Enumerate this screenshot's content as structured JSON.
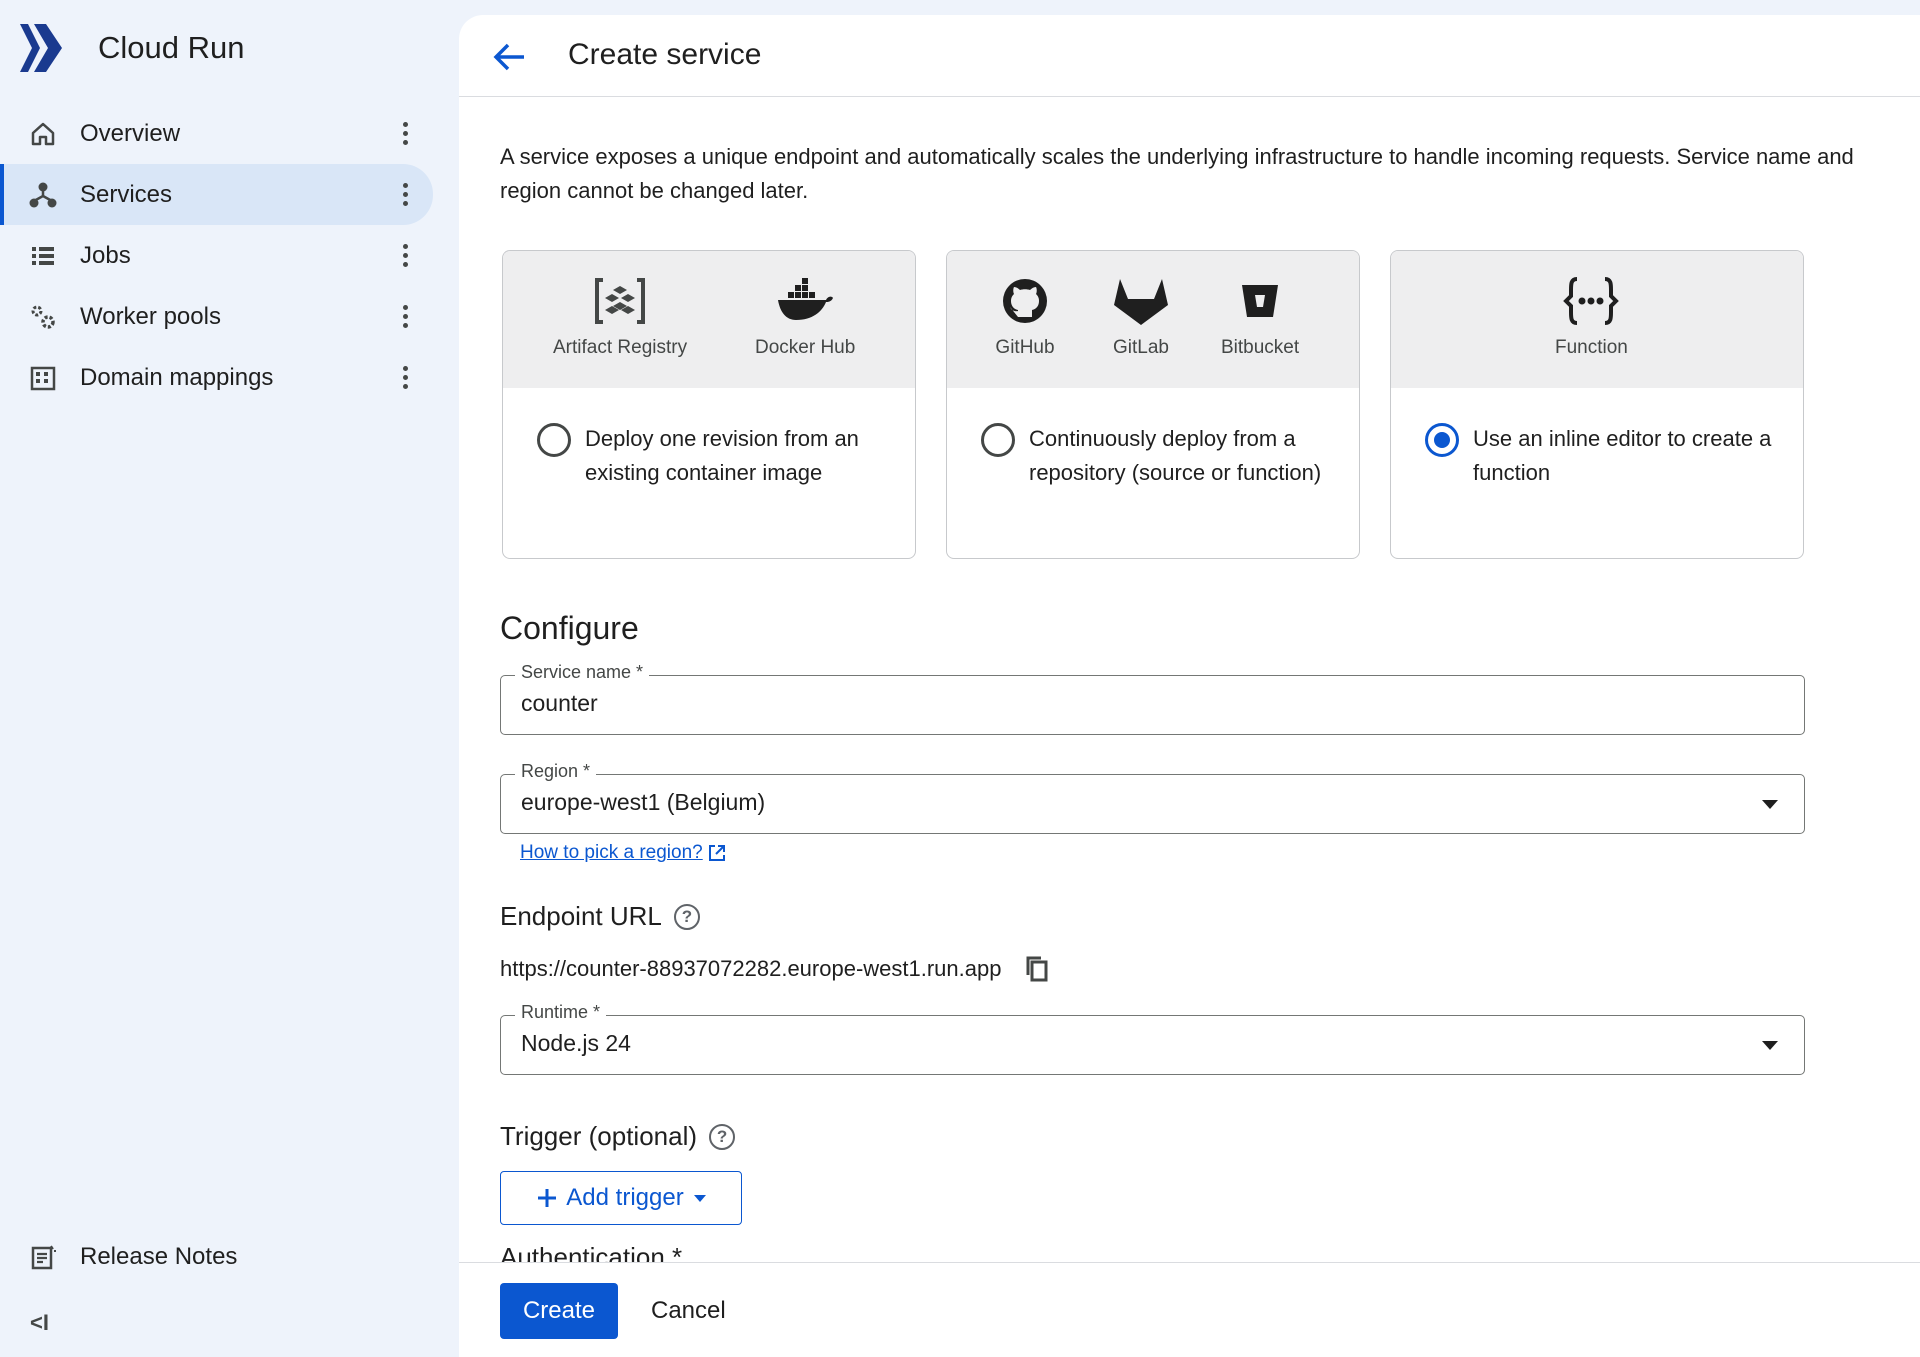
{
  "app": {
    "title": "Cloud Run"
  },
  "sidebar": {
    "items": [
      {
        "label": "Overview",
        "icon": "home-icon"
      },
      {
        "label": "Services",
        "icon": "services-icon",
        "active": true
      },
      {
        "label": "Jobs",
        "icon": "list-icon"
      },
      {
        "label": "Worker pools",
        "icon": "gears-icon"
      },
      {
        "label": "Domain mappings",
        "icon": "building-icon"
      }
    ],
    "release_notes": "Release Notes",
    "collapse_glyph": "<I"
  },
  "header": {
    "title": "Create service"
  },
  "description": "A service exposes a unique endpoint and automatically scales the underlying infrastructure to handle incoming requests. Service name and region cannot be changed later.",
  "deploy_options": [
    {
      "sources": [
        {
          "label": "Artifact Registry",
          "icon": "artifact-registry-icon"
        },
        {
          "label": "Docker Hub",
          "icon": "docker-icon"
        }
      ],
      "text": "Deploy one revision from an existing container image",
      "selected": false
    },
    {
      "sources": [
        {
          "label": "GitHub",
          "icon": "github-icon"
        },
        {
          "label": "GitLab",
          "icon": "gitlab-icon"
        },
        {
          "label": "Bitbucket",
          "icon": "bitbucket-icon"
        }
      ],
      "text": "Continuously deploy from a repository (source or function)",
      "selected": false
    },
    {
      "sources": [
        {
          "label": "Function",
          "icon": "function-icon"
        }
      ],
      "text": "Use an inline editor to create a function",
      "selected": true
    }
  ],
  "configure": {
    "title": "Configure",
    "service_name": {
      "label": "Service name *",
      "value": "counter"
    },
    "region": {
      "label": "Region *",
      "value": "europe-west1 (Belgium)"
    },
    "region_help_link": "How to pick a region?",
    "endpoint": {
      "title": "Endpoint URL",
      "url": "https://counter-88937072282.europe-west1.run.app"
    },
    "runtime": {
      "label": "Runtime *",
      "value": "Node.js 24"
    },
    "trigger": {
      "title": "Trigger (optional)",
      "button": "Add trigger"
    },
    "authentication": {
      "title": "Authentication *"
    }
  },
  "footer": {
    "create": "Create",
    "cancel": "Cancel"
  },
  "colors": {
    "accent": "#0b57d0",
    "sidebar_bg": "#eef3fb",
    "active_bg": "#d9e6f7"
  }
}
